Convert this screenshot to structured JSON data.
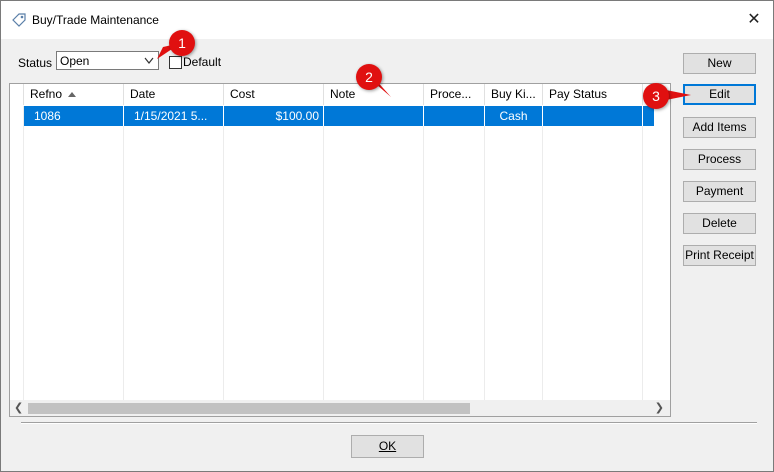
{
  "window": {
    "title": "Buy/Trade Maintenance",
    "close_glyph": "✕"
  },
  "filters": {
    "status_label": "Status",
    "status_value": "Open",
    "default_label": "Default",
    "default_checked": false
  },
  "grid": {
    "columns": [
      "Refno",
      "Date",
      "Cost",
      "Note",
      "Proce...",
      "Buy Ki...",
      "Pay Status"
    ],
    "sorted_column": "Refno",
    "rows": [
      {
        "refno": "1086",
        "date": "1/15/2021 5...",
        "cost": "$100.00",
        "note": "",
        "process": "",
        "buy_kind": "Cash",
        "pay_status": "",
        "selected": true
      }
    ],
    "selection_color": "#0078d7"
  },
  "actions": {
    "new": "New",
    "edit": "Edit",
    "add_items": "Add Items",
    "process": "Process",
    "payment": "Payment",
    "delete": "Delete",
    "print_receipt": "Print Receipt"
  },
  "footer": {
    "ok": "OK"
  },
  "annotations": {
    "marker_1": "1",
    "marker_2": "2",
    "marker_3": "3",
    "color": "#e01010"
  }
}
